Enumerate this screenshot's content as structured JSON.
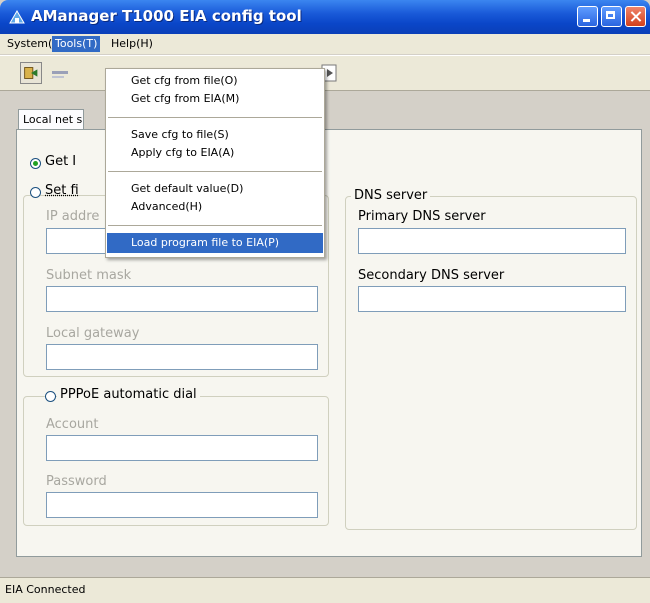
{
  "window": {
    "title": "AManager T1000 EIA config tool"
  },
  "menubar": {
    "system": "System(S)",
    "tools": "Tools(T)",
    "help": "Help(H)"
  },
  "tools_menu": {
    "items": [
      "Get cfg from file(O)",
      "Get cfg from EIA(M)",
      "Save cfg to file(S)",
      "Apply cfg to EIA(A)",
      "Get default value(D)",
      "Advanced(H)",
      "Load program file to EIA(P)"
    ],
    "highlighted": "Load program file to EIA(P)"
  },
  "tab": {
    "label": "Local net s"
  },
  "ip_section": {
    "option_get": "Get I",
    "option_set": "Set fi",
    "ip_address_label": "IP addre",
    "subnet_mask_label": "Subnet mask",
    "gateway_label": "Local gateway"
  },
  "pppoe": {
    "label": "PPPoE automatic dial",
    "account_label": "Account",
    "password_label": "Password"
  },
  "dns": {
    "group_label": "DNS server",
    "primary_label": "Primary DNS server",
    "secondary_label": "Secondary DNS server"
  },
  "status": {
    "text": "EIA Connected"
  },
  "colors": {
    "title_bar": "#0a46c8",
    "menu_highlight": "#316ac5",
    "window_bg": "#d4d0c8"
  },
  "icons": {
    "app": "app-icon",
    "toolbar": [
      "get-config-icon",
      "save-icon",
      "apply-icon"
    ]
  }
}
